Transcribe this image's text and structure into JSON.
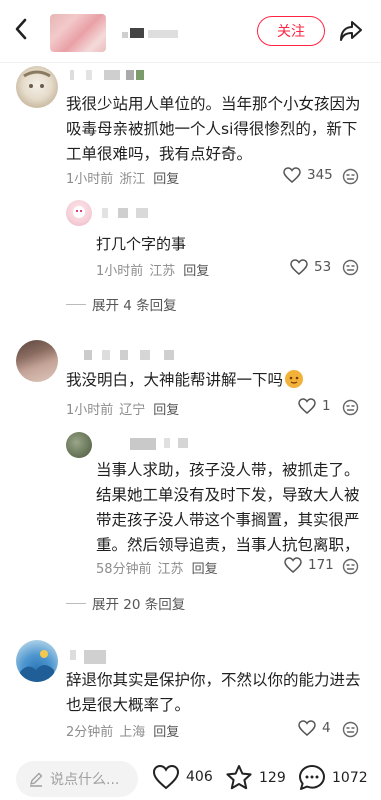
{
  "header": {
    "follow_label": "关注"
  },
  "comments": [
    {
      "text": "我很少站用人单位的。当年那个小女孩因为吸毒母亲被抓她一个人si得很惨烈的，新下工单很难吗，我有点好奇。",
      "time": "1小时前",
      "location": "浙江",
      "reply_label": "回复",
      "likes": "345",
      "replies": [
        {
          "text": "打几个字的事",
          "time": "1小时前",
          "location": "江苏",
          "reply_label": "回复",
          "likes": "53"
        }
      ],
      "expand_label": "展开 4 条回复"
    },
    {
      "text": "我没明白，大神能帮讲解一下吗",
      "time": "1小时前",
      "location": "辽宁",
      "reply_label": "回复",
      "likes": "1",
      "replies": [
        {
          "text": "当事人求助，孩子没人带，被抓走了。结果她工单没有及时下发，导致大人被带走孩子没人带这个事搁置，其实很严重。然后领导追责，当事人抗包离职，",
          "time": "58分钟前",
          "location": "江苏",
          "reply_label": "回复",
          "likes": "171"
        }
      ],
      "expand_label": "展开 20 条回复"
    },
    {
      "text": "辞退你其实是保护你，不然以你的能力进去也是很大概率了。",
      "time": "2分钟前",
      "location": "上海",
      "reply_label": "回复",
      "likes": "4"
    }
  ],
  "bottom": {
    "input_placeholder": "说点什么...",
    "like_count": "406",
    "star_count": "129",
    "comment_count": "1072"
  }
}
